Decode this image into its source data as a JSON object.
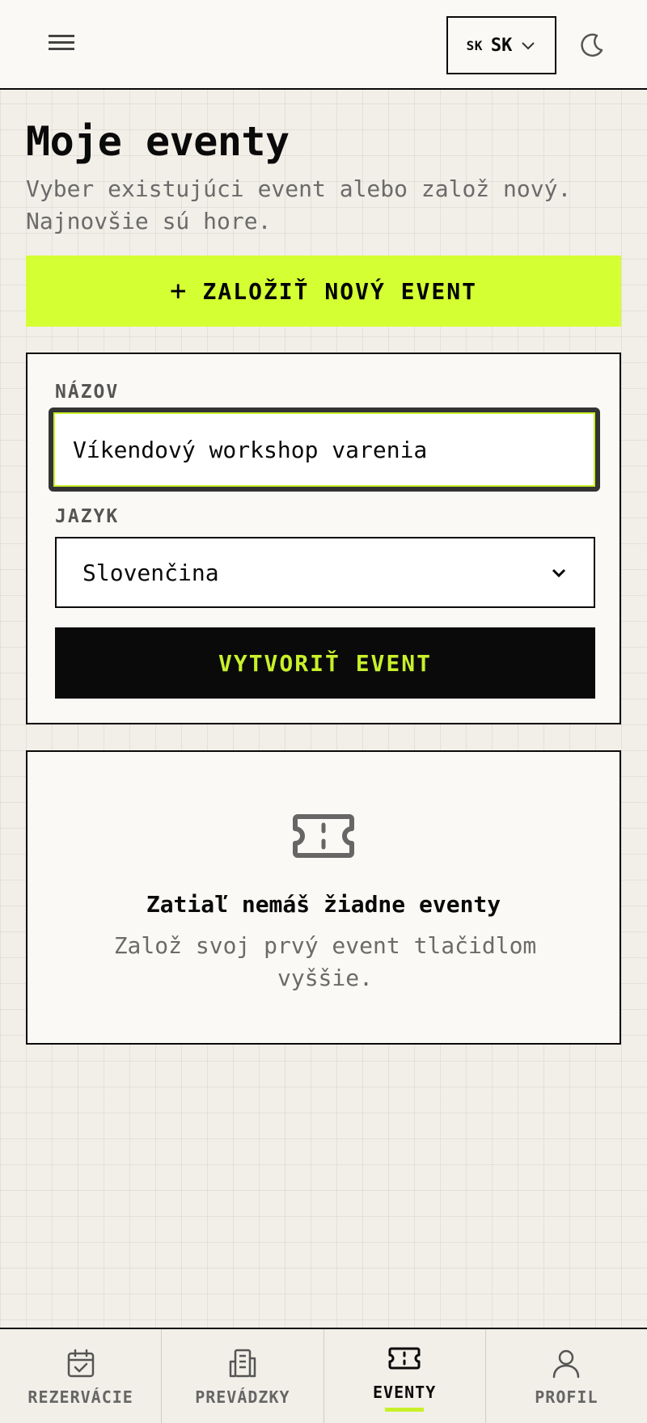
{
  "header": {
    "lang_flag": "SK",
    "lang_code": "SK"
  },
  "main": {
    "title": "Moje eventy",
    "subtitle": "Vyber existujúci event alebo založ nový. Najnovšie sú hore.",
    "new_event_label": "ZALOŽIŤ NOVÝ EVENT",
    "form": {
      "name_label": "NÁZOV",
      "name_value": "Víkendový workshop varenia",
      "language_label": "JAZYK",
      "language_value": "Slovenčina",
      "submit_label": "VYTVORIŤ EVENT"
    },
    "empty_state": {
      "icon": "ticket-icon",
      "title": "Zatiaľ nemáš žiadne eventy",
      "text": "Založ svoj prvý event tlačidlom vyššie."
    }
  },
  "bottom_nav": {
    "items": [
      {
        "label": "REZERVÁCIE",
        "icon": "calendar-check-icon"
      },
      {
        "label": "PREVÁDZKY",
        "icon": "building-icon"
      },
      {
        "label": "EVENTY",
        "icon": "ticket-icon",
        "active": true
      },
      {
        "label": "PROFIL",
        "icon": "user-icon"
      }
    ]
  },
  "colors": {
    "accent": "#d4ff33",
    "dark": "#0a0a0a",
    "background": "#f2efe8"
  }
}
